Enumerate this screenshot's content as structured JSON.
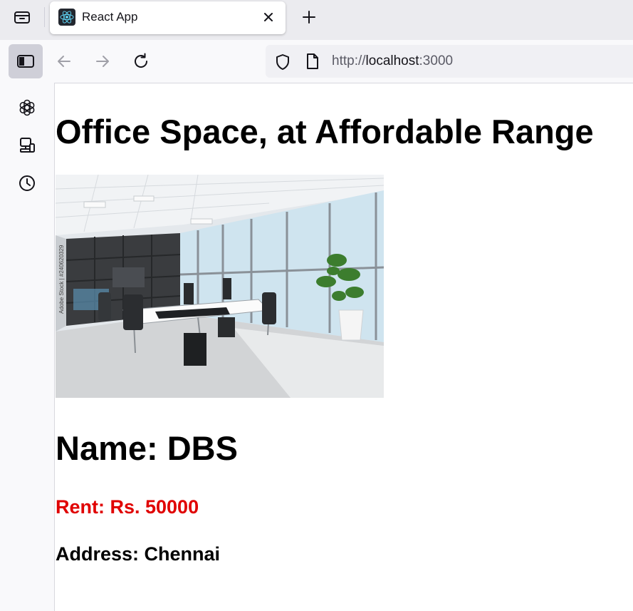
{
  "browser": {
    "tab": {
      "title": "React App",
      "favicon": "react-logo-icon"
    },
    "url": {
      "scheme": "http://",
      "host": "localhost",
      "port": ":3000"
    },
    "icons": {
      "tab_list": "tab-list-icon",
      "close": "close-icon",
      "new_tab": "plus-icon",
      "sidebar": "sidebar-icon",
      "back": "back-arrow-icon",
      "forward": "forward-arrow-icon",
      "reload": "reload-icon",
      "shield": "shield-icon",
      "page": "page-icon"
    },
    "sidebar_items": [
      "chatgpt-icon",
      "synced-devices-icon",
      "history-icon"
    ]
  },
  "page": {
    "title": "Office Space, at Affordable Range",
    "image_watermark": "Adobe Stock | #240620329",
    "name_label": "Name: DBS",
    "rent_label": "Rent: Rs. 50000",
    "address_label": "Address: Chennai"
  },
  "colors": {
    "rent": "#e00000",
    "tabbar": "#ebebef",
    "toolbar": "#f9f9fb",
    "sidebar_toggle_active": "#cfcfd8"
  }
}
